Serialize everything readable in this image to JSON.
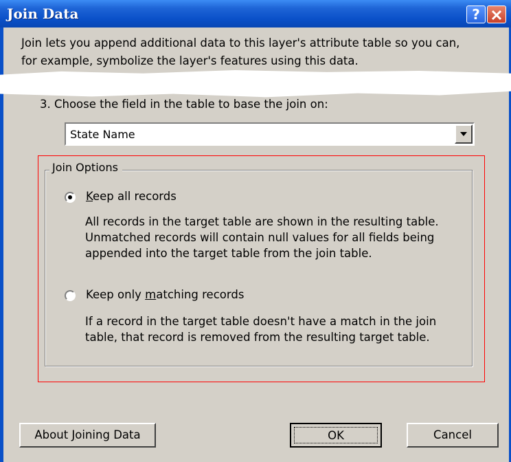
{
  "window": {
    "title": "Join Data",
    "help_label": "?"
  },
  "intro": {
    "line1": "Join lets you append additional data to this layer's attribute table so you can,",
    "line2": "for example, symbolize the layer's features using this data."
  },
  "step3": {
    "label": "3.  Choose the field in the table to base the join on:"
  },
  "field_select": {
    "value": "State Name"
  },
  "join_options": {
    "legend": "Join Options",
    "options": [
      {
        "label_prefix": "",
        "label_mnemonic": "K",
        "label_rest": "eep all records",
        "selected": true,
        "desc_line1": "All records in the target table are shown in the resulting table.",
        "desc_line2": "Unmatched records will contain null values for all fields being",
        "desc_line3": "appended into the target table from the join table."
      },
      {
        "label_prefix": "Keep only ",
        "label_mnemonic": "m",
        "label_rest": "atching records",
        "selected": false,
        "desc_line1": "If a record in the target table doesn't have a match in the join",
        "desc_line2": "table, that record is removed from the resulting target table."
      }
    ]
  },
  "buttons": {
    "about_prefix": "About ",
    "about_mnemonic": "J",
    "about_rest": "oining Data",
    "ok": "OK",
    "cancel": "Cancel"
  }
}
